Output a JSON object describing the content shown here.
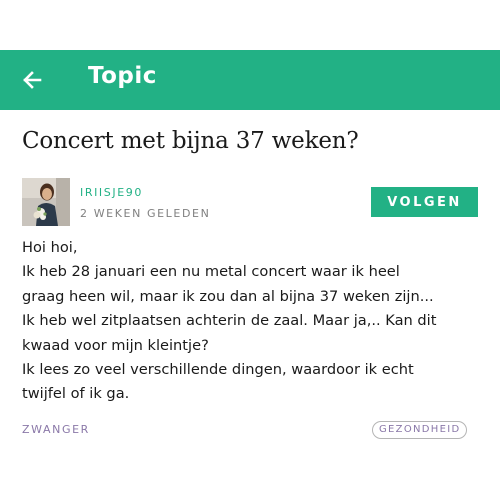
{
  "header": {
    "title": "Topic",
    "back_icon": "arrow-left-icon",
    "background_color": "#22b185"
  },
  "topic": {
    "title": "Concert met bijna 37 weken?"
  },
  "author": {
    "name": "IRIISJE90",
    "time_ago": "2 WEKEN GELEDEN",
    "avatar_icon": "avatar-photo"
  },
  "follow_button": {
    "label": "VOLGEN"
  },
  "post": {
    "lines": [
      "Hoi hoi,",
      "Ik heb 28 januari een nu metal concert waar ik heel",
      "graag heen wil, maar ik zou dan al bijna 37 weken zijn...",
      "Ik heb wel zitplaatsen achterin de zaal. Maar ja,.. Kan dit",
      "kwaad voor mijn kleintje?",
      "Ik lees zo veel verschillende dingen, waardoor ik echt",
      "twijfel of ik ga."
    ]
  },
  "footer": {
    "category": "ZWANGER",
    "tag": "GEZONDHEID"
  },
  "colors": {
    "accent": "#22b185",
    "tag_text": "#8a78a8",
    "muted": "#808080"
  }
}
